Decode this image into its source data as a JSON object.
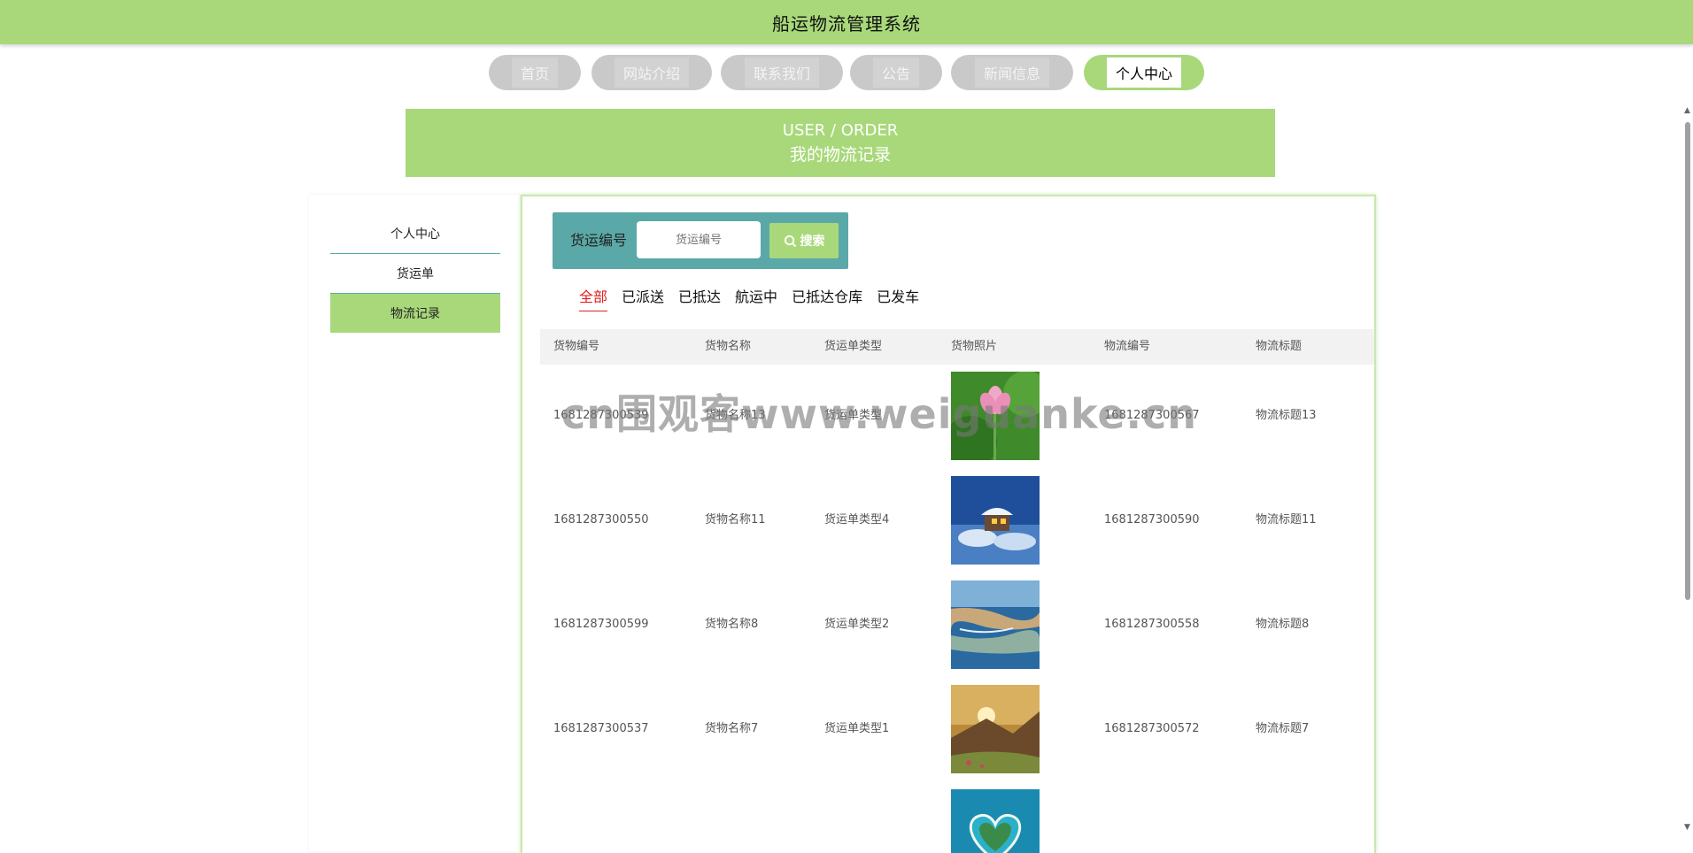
{
  "header": {
    "title": "船运物流管理系统"
  },
  "nav": {
    "items": [
      {
        "label": "首页"
      },
      {
        "label": "网站介绍"
      },
      {
        "label": "联系我们"
      },
      {
        "label": "公告"
      },
      {
        "label": "新闻信息"
      },
      {
        "label": "个人中心"
      }
    ],
    "active_index": 5
  },
  "banner": {
    "en": "USER / ORDER",
    "cn": "我的物流记录"
  },
  "sidebar": {
    "items": [
      {
        "label": "个人中心"
      },
      {
        "label": "货运单"
      },
      {
        "label": "物流记录"
      }
    ],
    "active_index": 2
  },
  "search": {
    "label": "货运编号",
    "placeholder": "货运编号",
    "button_label": "搜索"
  },
  "tabs": {
    "items": [
      "全部",
      "已派送",
      "已抵达",
      "航运中",
      "已抵达仓库",
      "已发车"
    ],
    "active_index": 0
  },
  "table": {
    "columns": [
      "货物编号",
      "货物名称",
      "货运单类型",
      "货物照片",
      "物流编号",
      "物流标题"
    ],
    "rows": [
      {
        "goods_no": "1681287300539",
        "goods_name": "货物名称13",
        "type": "货运单类型",
        "photo": "lotus-flower",
        "logistics_no": "1681287300567",
        "logistics_title": "物流标题13"
      },
      {
        "goods_no": "1681287300550",
        "goods_name": "货物名称11",
        "type": "货运单类型4",
        "photo": "snow-cabin",
        "logistics_no": "1681287300590",
        "logistics_title": "物流标题11"
      },
      {
        "goods_no": "1681287300599",
        "goods_name": "货物名称8",
        "type": "货运单类型2",
        "photo": "aerial-coast",
        "logistics_no": "1681287300558",
        "logistics_title": "物流标题8"
      },
      {
        "goods_no": "1681287300537",
        "goods_name": "货物名称7",
        "type": "货运单类型1",
        "photo": "mountain-sunset",
        "logistics_no": "1681287300572",
        "logistics_title": "物流标题7"
      },
      {
        "goods_no": "",
        "goods_name": "",
        "type": "",
        "photo": "heart-island",
        "logistics_no": "",
        "logistics_title": ""
      }
    ]
  },
  "watermark": "cn围观客www.weiguanke.cn",
  "colors": {
    "accent": "#a8d87a",
    "search_bg": "#5aa8a8",
    "active_tab": "#e02020"
  }
}
